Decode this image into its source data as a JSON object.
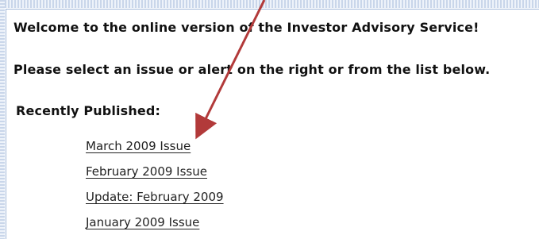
{
  "content": {
    "welcome_text": "Welcome to the online version of the Investor Advisory Service!",
    "instruction_text": "Please select an issue or alert on the right or from the list below.",
    "recent_heading": "Recently Published:",
    "issues": [
      {
        "label": "March 2009 Issue"
      },
      {
        "label": "February 2009 Issue"
      },
      {
        "label": "Update: February 2009"
      },
      {
        "label": "January 2009 Issue"
      }
    ]
  },
  "annotation": {
    "arrow_color": "#b23a3a"
  }
}
